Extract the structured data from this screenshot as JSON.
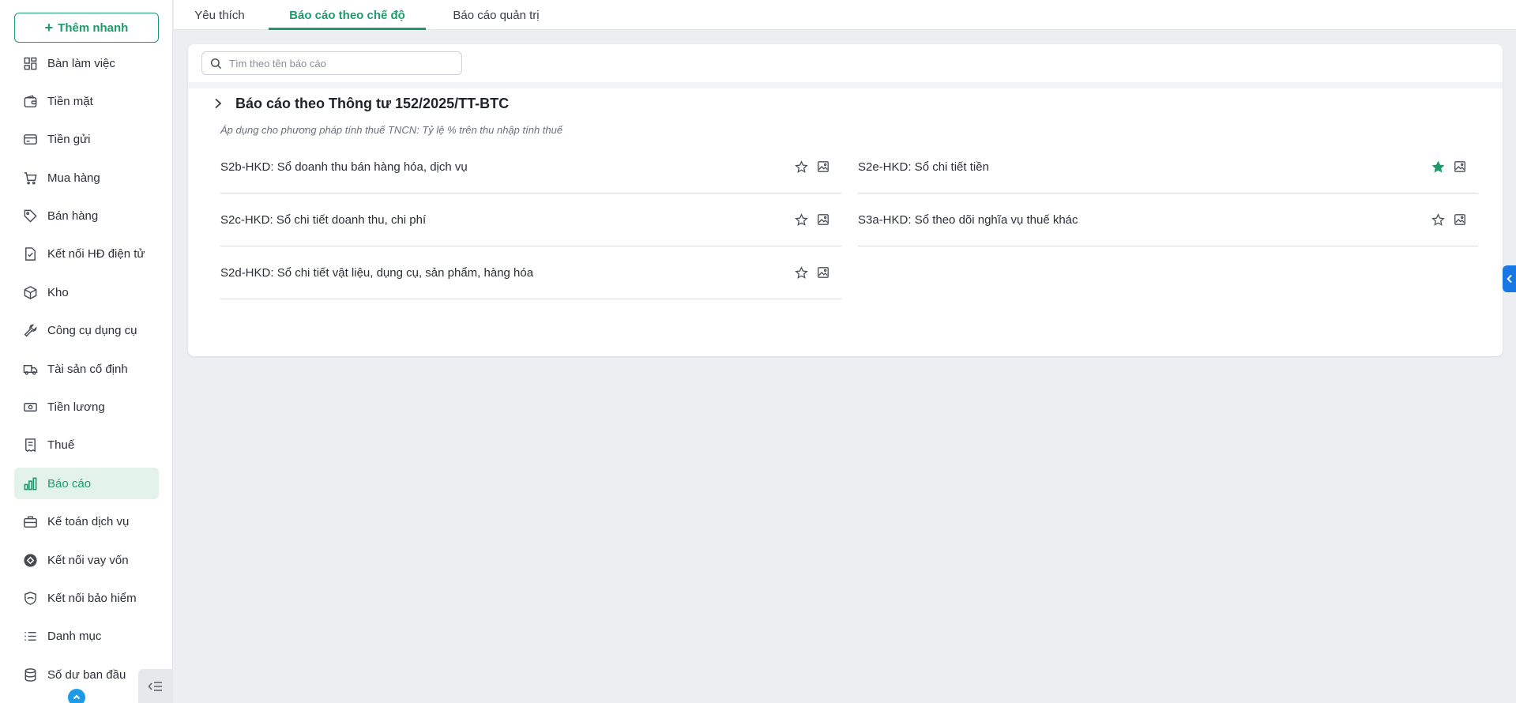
{
  "sidebar": {
    "quick_add_label": "Thêm nhanh",
    "items": [
      {
        "label": "Bàn làm việc",
        "icon": "dashboard-icon"
      },
      {
        "label": "Tiền mặt",
        "icon": "wallet-icon"
      },
      {
        "label": "Tiền gửi",
        "icon": "credit-card-icon"
      },
      {
        "label": "Mua hàng",
        "icon": "cart-icon"
      },
      {
        "label": "Bán hàng",
        "icon": "tag-icon"
      },
      {
        "label": "Kết nối HĐ điện tử",
        "icon": "e-invoice-icon"
      },
      {
        "label": "Kho",
        "icon": "box-icon"
      },
      {
        "label": "Công cụ dụng cụ",
        "icon": "wrench-icon"
      },
      {
        "label": "Tài sản cố định",
        "icon": "truck-icon"
      },
      {
        "label": "Tiền lương",
        "icon": "cash-icon"
      },
      {
        "label": "Thuế",
        "icon": "receipt-icon"
      },
      {
        "label": "Báo cáo",
        "icon": "bar-chart-icon",
        "active": true
      },
      {
        "label": "Kế toán dịch vụ",
        "icon": "briefcase-icon"
      },
      {
        "label": "Kết nối vay vốn",
        "icon": "loan-icon"
      },
      {
        "label": "Kết nối bảo hiểm",
        "icon": "shield-icon"
      },
      {
        "label": "Danh mục",
        "icon": "list-icon"
      },
      {
        "label": "Số dư ban đầu",
        "icon": "database-icon"
      }
    ]
  },
  "tabs": [
    {
      "label": "Yêu thích"
    },
    {
      "label": "Báo cáo theo chế độ",
      "active": true
    },
    {
      "label": "Báo cáo quản trị"
    }
  ],
  "search": {
    "placeholder": "Tìm theo tên báo cáo",
    "value": ""
  },
  "section": {
    "title": "Báo cáo theo Thông tư 152/2025/TT-BTC",
    "note": "Áp dụng cho phương pháp tính thuế TNCN: Tỷ lệ % trên thu nhập tính thuế"
  },
  "reports": [
    {
      "name": "S2b-HKD: Sổ doanh thu bán hàng hóa, dịch vụ",
      "favorite": false
    },
    {
      "name": "S2e-HKD: Sổ chi tiết tiền",
      "favorite": true
    },
    {
      "name": "S2c-HKD: Sổ chi tiết doanh thu, chi phí",
      "favorite": false
    },
    {
      "name": "S3a-HKD: Sổ theo dõi nghĩa vụ thuế khác",
      "favorite": false
    },
    {
      "name": "S2d-HKD: Sổ chi tiết vật liệu, dụng cụ, sản phẩm, hàng hóa",
      "favorite": false
    }
  ],
  "colors": {
    "accent": "#1d9b6c",
    "active_bg": "#e3f2ea",
    "blue": "#1677e5"
  }
}
